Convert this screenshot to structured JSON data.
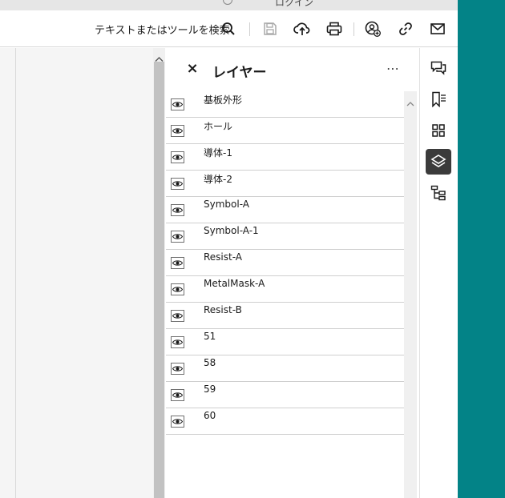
{
  "top_strip": {
    "partial_label": "ロクイン"
  },
  "toolbar": {
    "search_label": "テキストまたはツールを検索",
    "icons": [
      "search-icon",
      "save-icon",
      "cloud-upload-icon",
      "print-icon",
      "share-user-icon",
      "link-icon",
      "mail-icon"
    ]
  },
  "panel": {
    "title": "レイヤー",
    "close_glyph": "×",
    "more_glyph": "⋯",
    "layers": [
      {
        "name": "基板外形",
        "visible": true
      },
      {
        "name": "ホール",
        "visible": true
      },
      {
        "name": "導体-1",
        "visible": true
      },
      {
        "name": "導体-2",
        "visible": true
      },
      {
        "name": "Symbol-A",
        "visible": true
      },
      {
        "name": "Symbol-A-1",
        "visible": true
      },
      {
        "name": "Resist-A",
        "visible": true
      },
      {
        "name": "MetalMask-A",
        "visible": true
      },
      {
        "name": "Resist-B",
        "visible": true
      },
      {
        "name": "51",
        "visible": true
      },
      {
        "name": "58",
        "visible": true
      },
      {
        "name": "59",
        "visible": true
      },
      {
        "name": "60",
        "visible": true
      }
    ]
  },
  "rail": {
    "items": [
      {
        "icon": "comments-icon",
        "active": false
      },
      {
        "icon": "bookmark-icon",
        "active": false
      },
      {
        "icon": "thumbnails-icon",
        "active": false
      },
      {
        "icon": "layers-icon",
        "active": true
      },
      {
        "icon": "structure-tree-icon",
        "active": false
      }
    ]
  },
  "colors": {
    "accent_teal": "#038387",
    "active_rail": "#3b3b3b"
  }
}
